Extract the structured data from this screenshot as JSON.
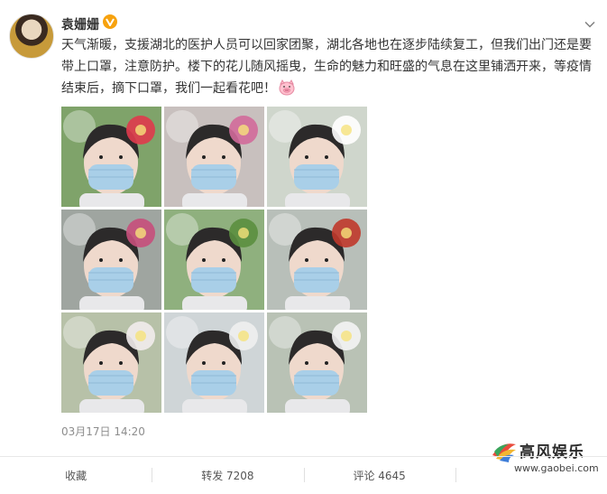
{
  "post": {
    "username": "袁姗姗",
    "text": "天气渐暖，支援湖北的医护人员可以回家团聚，湖北各地也在逐步陆续复工，但我们出门还是要带上口罩，注意防护。楼下的花儿随风摇曳，生命的魅力和旺盛的气息在这里铺洒开来，等疫情结束后，摘下口罩，我们一起看花吧！",
    "emoji_icon": "pig-face-emoji-icon",
    "timestamp": "03月17日 14:20",
    "photos": [
      {
        "name": "photo-1",
        "tone": "#7fa36a",
        "flower": "#e03a4c"
      },
      {
        "name": "photo-2",
        "tone": "#c8c0be",
        "flower": "#d26a9a"
      },
      {
        "name": "photo-3",
        "tone": "#cfd6cc",
        "flower": "#ffffff"
      },
      {
        "name": "photo-4",
        "tone": "#9fa5a0",
        "flower": "#c74f7b"
      },
      {
        "name": "photo-5",
        "tone": "#8fb07e",
        "flower": "#5b8f3f"
      },
      {
        "name": "photo-6",
        "tone": "#b8bfb9",
        "flower": "#c0392b"
      },
      {
        "name": "photo-7",
        "tone": "#b7c1a8",
        "flower": "#f2ecec"
      },
      {
        "name": "photo-8",
        "tone": "#cfd5d7",
        "flower": "#eef0f0"
      },
      {
        "name": "photo-9",
        "tone": "#b9c2b5",
        "flower": "#f4f4f4"
      }
    ]
  },
  "actions": {
    "favorite": "收藏",
    "repost": "转发 7208",
    "comment": "评论 4645",
    "like": ""
  },
  "watermark": {
    "title": "高风娱乐",
    "url": "www.gaobei.com"
  },
  "colors": {
    "verified_badge": "#f7a20e",
    "text": "#333333",
    "muted": "#8d8d8d"
  }
}
